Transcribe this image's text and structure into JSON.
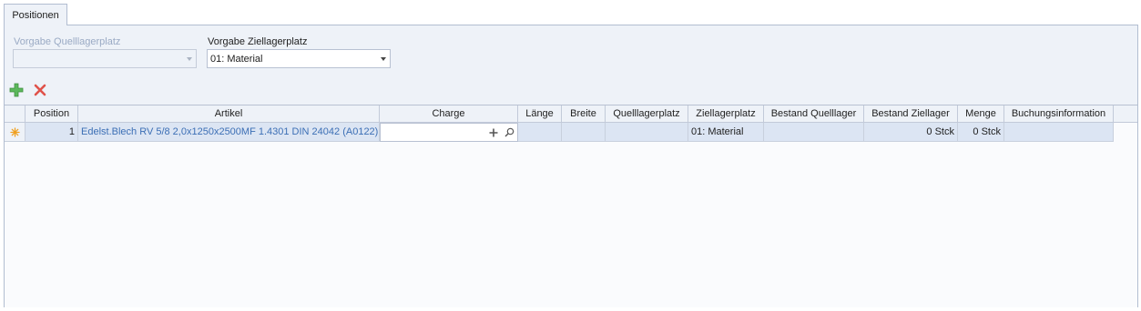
{
  "tabs": [
    {
      "label": "Positionen"
    }
  ],
  "filters": {
    "source_label": "Vorgabe Quelllagerplatz",
    "source_value": "",
    "target_label": "Vorgabe Ziellagerplatz",
    "target_value": "01: Material"
  },
  "toolbar": {
    "add_icon": "plus-icon",
    "delete_icon": "close-icon",
    "add_color": "#4caf50",
    "delete_color": "#e0524a"
  },
  "grid": {
    "columns": [
      "Position",
      "Artikel",
      "Charge",
      "Länge",
      "Breite",
      "Quelllagerplatz",
      "Ziellagerplatz",
      "Bestand Quelllager",
      "Bestand Ziellager",
      "Menge",
      "Buchungsinformation"
    ],
    "rows": [
      {
        "indicator": "new-row-icon",
        "position": "1",
        "artikel": "Edelst.Blech RV 5/8 2,0x1250x2500MF 1.4301  DIN 24042 (A0122)",
        "charge": "",
        "laenge": "",
        "breite": "",
        "quelllagerplatz": "",
        "ziellagerplatz": "01: Material",
        "bestand_quelllager": "",
        "bestand_ziellager": "0 Stck",
        "menge": "0 Stck",
        "buchungsinformation": ""
      }
    ]
  }
}
